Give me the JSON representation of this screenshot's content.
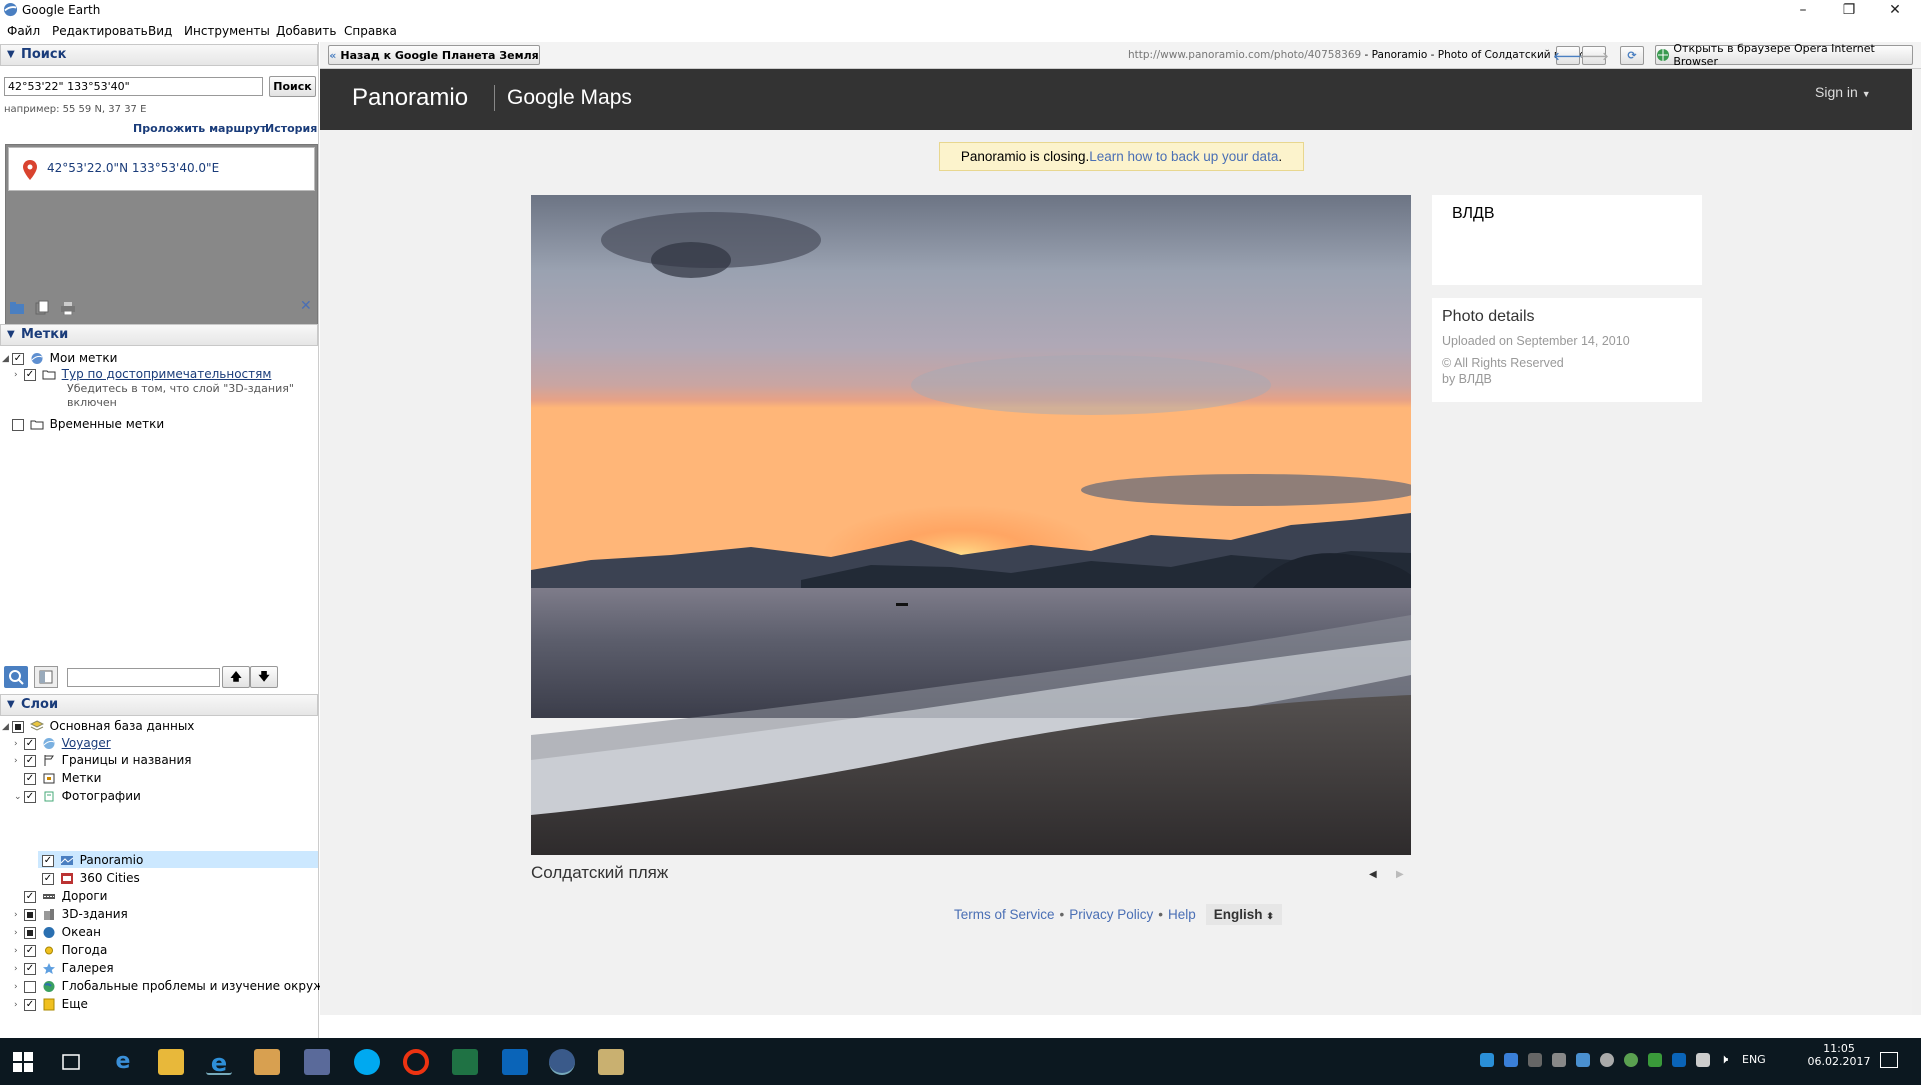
{
  "window": {
    "title": "Google Earth",
    "controls": [
      "–",
      "❐",
      "✕"
    ]
  },
  "menu": [
    "Файл",
    "Редактировать",
    "Вид",
    "Инструменты",
    "Добавить",
    "Справка"
  ],
  "search": {
    "header": "Поиск",
    "input_value": "42°53'22\" 133°53'40\"",
    "button": "Поиск",
    "hint": "например: 55 59 N, 37 37 E",
    "route_link": "Проложить маршрут",
    "history_link": "История",
    "result": "42°53'22.0\"N 133°53'40.0\"E"
  },
  "places": {
    "header": "Метки",
    "items": [
      {
        "label": "Мои метки"
      },
      {
        "label": "Тур по достопримечательностям",
        "note": "Убедитесь в том, что слой \"3D-здания\"",
        "note2": "включен"
      },
      {
        "label": "Временные метки"
      }
    ]
  },
  "layers": {
    "header": "Слои",
    "items": [
      "Основная база данных",
      "Voyager",
      "Границы и названия",
      "Метки",
      "Фотографии",
      "Panoramio",
      "360 Cities",
      "Дороги",
      "3D-здания",
      "Океан",
      "Погода",
      "Галерея",
      "Глобальные проблемы и изучение окружа...",
      "Еще"
    ]
  },
  "browser": {
    "back_button": "Назад к Google Планета Земля",
    "url": "http://www.panoramio.com/photo/40758369",
    "page_title": " - Panoramio - Photo of Солдатский пляж",
    "open_in": "Открыть в браузере Opera Internet Browser"
  },
  "panoramio": {
    "logo": "Panoramio",
    "logo_sub": "Google Maps",
    "signin": "Sign in",
    "notice_text": "Panoramio is closing. ",
    "notice_link": "Learn how to back up your data",
    "notice_end": ".",
    "photo_title": "Солдатский пляж",
    "author": "ВЛДВ",
    "details_header": "Photo details",
    "uploaded": "Uploaded on September 14, 2010",
    "rights": "© All Rights Reserved",
    "by": "by ВЛДВ",
    "footer": {
      "terms": "Terms of Service",
      "privacy": "Privacy Policy",
      "help": "Help",
      "language": "English"
    }
  },
  "taskbar": {
    "lang": "ENG",
    "time": "11:05",
    "date": "06.02.2017"
  },
  "colors": {
    "panoramio_header": "#333333",
    "notice_bg": "#fcf3cc",
    "link": "#4a6fb5",
    "selection": "#cce8ff",
    "sidebar_header_text": "#1a3c7a",
    "taskbar": "#0c1820"
  }
}
